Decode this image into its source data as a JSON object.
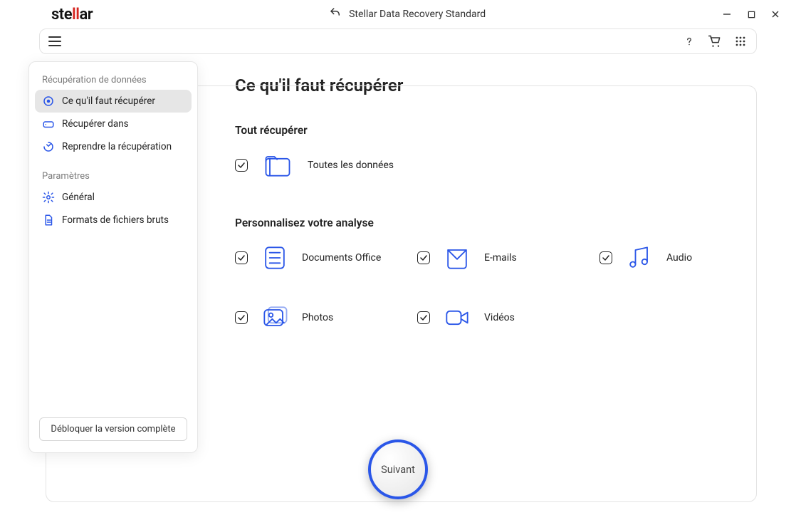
{
  "app": {
    "logo_pre": "ste",
    "logo_mid": "ll",
    "logo_post": "ar",
    "title": "Stellar Data Recovery Standard"
  },
  "toolbar": {},
  "sidebar": {
    "section1_title": "Récupération de données",
    "items1": [
      {
        "label": "Ce qu'il faut récupérer"
      },
      {
        "label": "Récupérer dans"
      },
      {
        "label": "Reprendre la récupération"
      }
    ],
    "section2_title": "Paramètres",
    "items2": [
      {
        "label": "Général"
      },
      {
        "label": "Formats de fichiers bruts"
      }
    ],
    "unlock_label": "Débloquer la version complète"
  },
  "content": {
    "page_title": "Ce qu'il faut récupérer",
    "section_all": "Tout récupérer",
    "all_data_label": "Toutes les données",
    "section_custom": "Personnalisez votre analyse",
    "categories": [
      {
        "label": "Documents Office"
      },
      {
        "label": "E-mails"
      },
      {
        "label": "Audio"
      },
      {
        "label": "Photos"
      },
      {
        "label": "Vidéos"
      }
    ],
    "next_label": "Suivant"
  }
}
